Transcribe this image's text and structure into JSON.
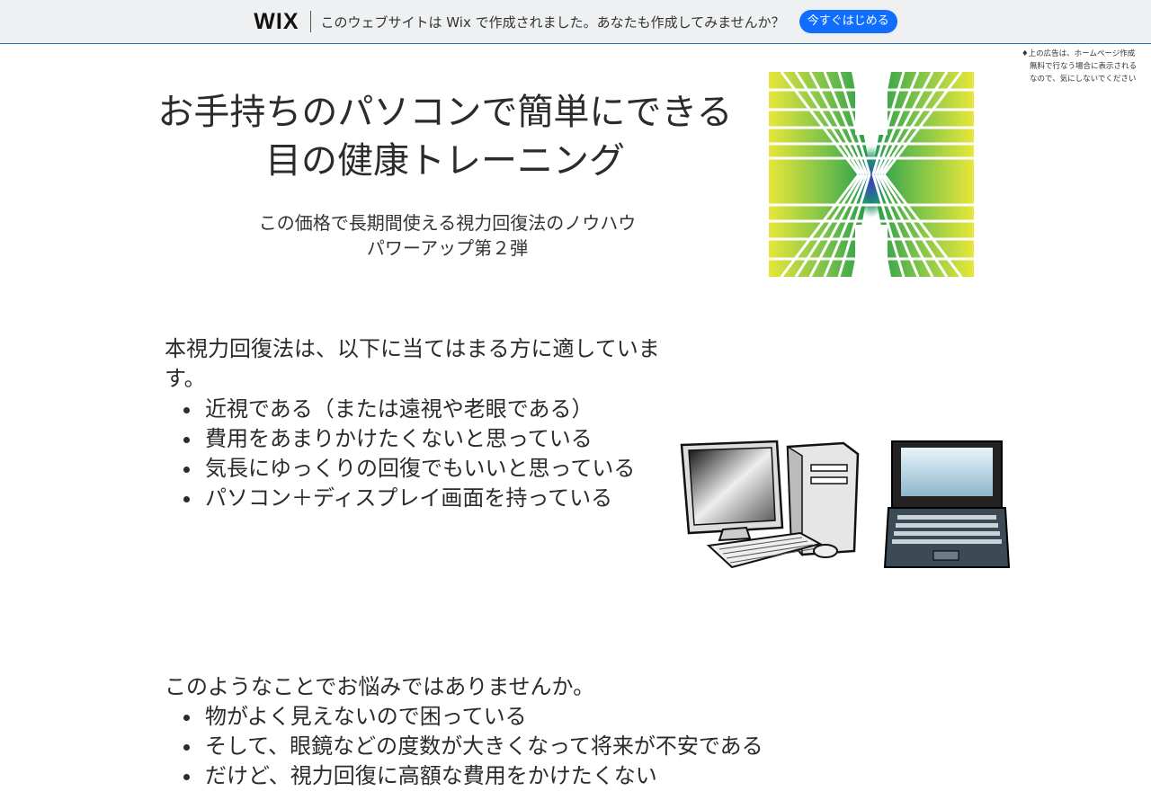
{
  "wix_bar": {
    "logo": "WIX",
    "message": "このウェブサイトは Wix で作成されました。あなたも作成してみませんか？",
    "cta": "今すぐはじめる"
  },
  "ad_note": {
    "line1": "♦上の広告は、ホームページ作成",
    "line2": "無料で行なう場合に表示される",
    "line3": "なので、気にしないでください"
  },
  "hero": {
    "title_line1": "お手持ちのパソコンで簡単にできる",
    "title_line2": "目の健康トレーニング",
    "subtitle_line1": "この価格で長期間使える視力回復法のノウハウ",
    "subtitle_line2": "パワーアップ第２弾"
  },
  "section1": {
    "lead_line1": "本視力回復法は、以下に当てはまる方に適していま",
    "lead_line2": "す。",
    "items": [
      "近視である（または遠視や老眼である）",
      "費用をあまりかけたくないと思っている",
      "気長にゆっくりの回復でもいいと思っている",
      "パソコン＋ディスプレイ画面を持っている"
    ]
  },
  "section2": {
    "lead": "このようなことでお悩みではありませんか。",
    "items": [
      "物がよく見えないので困っている",
      "そして、眼鏡などの度数が大きくなって将来が不安である",
      "だけど、視力回復に高額な費用をかけたくない"
    ]
  },
  "colors": {
    "wix_bar_bg": "#eef0f2",
    "wix_button": "#116dff",
    "text": "#2b2b2b"
  },
  "icons": {
    "hero_art": "eye-training-pattern-icon",
    "illustration": "desktop-and-laptop-computer-icon"
  }
}
